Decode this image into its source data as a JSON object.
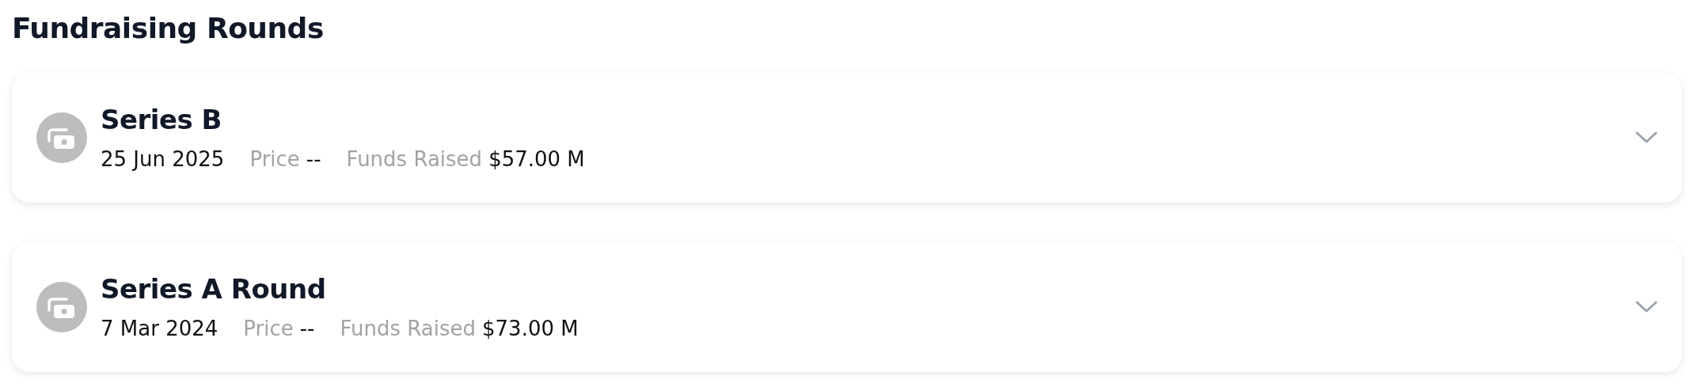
{
  "title": "Fundraising Rounds",
  "rounds": [
    {
      "name": "Series B",
      "date": "25 Jun 2025",
      "price_label": "Price",
      "price": "--",
      "funds_label": "Funds Raised",
      "funds": "$57.00 M",
      "expanded": false
    },
    {
      "name": "Series A Round",
      "date": "7 Mar 2024",
      "price_label": "Price",
      "price": "--",
      "funds_label": "Funds Raised",
      "funds": "$73.00 M",
      "expanded": false
    }
  ]
}
